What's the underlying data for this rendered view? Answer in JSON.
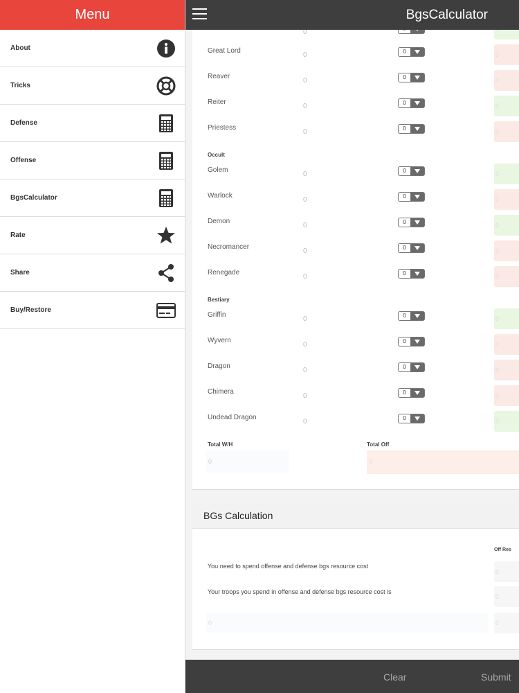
{
  "sidebar": {
    "title": "Menu",
    "items": [
      {
        "label": "About",
        "icon": "info-icon"
      },
      {
        "label": "Tricks",
        "icon": "lifebuoy-icon"
      },
      {
        "label": "Defense",
        "icon": "calculator-icon"
      },
      {
        "label": "Offense",
        "icon": "calculator-icon"
      },
      {
        "label": "BgsCalculator",
        "icon": "calculator-icon"
      },
      {
        "label": "Rate",
        "icon": "star-icon"
      },
      {
        "label": "Share",
        "icon": "share-icon"
      },
      {
        "label": "Buy/Restore",
        "icon": "credit-card-icon"
      }
    ]
  },
  "topbar": {
    "title": "BgsCalculator"
  },
  "units": {
    "top_partial": {
      "select_value": "0",
      "value": "0"
    },
    "rows": [
      {
        "name": "Great Lord",
        "value": "0",
        "select_value": "0"
      },
      {
        "name": "Reaver",
        "value": "0",
        "select_value": "0"
      },
      {
        "name": "Reiter",
        "value": "0",
        "select_value": "0"
      },
      {
        "name": "Priestess",
        "value": "0",
        "select_value": "0"
      },
      {
        "name": "Golem",
        "value": "0",
        "select_value": "0"
      },
      {
        "name": "Warlock",
        "value": "0",
        "select_value": "0"
      },
      {
        "name": "Demon",
        "value": "0",
        "select_value": "0"
      },
      {
        "name": "Necromancer",
        "value": "0",
        "select_value": "0"
      },
      {
        "name": "Renegade",
        "value": "0",
        "select_value": "0"
      },
      {
        "name": "Griffin",
        "value": "0",
        "select_value": "0"
      },
      {
        "name": "Wyvern",
        "value": "0",
        "select_value": "0"
      },
      {
        "name": "Dragon",
        "value": "0",
        "select_value": "0"
      },
      {
        "name": "Chimera",
        "value": "0",
        "select_value": "0"
      },
      {
        "name": "Undead Dragon",
        "value": "0",
        "select_value": "0"
      }
    ],
    "sections": {
      "occult": "Occult",
      "bestiary": "Bestiary"
    },
    "total_wh_label": "Total W/H",
    "total_off_label": "Total Off",
    "total_wh_value": "0",
    "total_off_value": "0",
    "res_values": [
      "0",
      "0",
      "0",
      "0",
      "0",
      "0",
      "0",
      "0",
      "0",
      "0",
      "0",
      "0",
      "0",
      "0",
      "0",
      "0"
    ]
  },
  "calculation": {
    "title": "BGs Calculation",
    "off_res_label": "Off Res",
    "line1": "You need to spend offense and defense bgs resource cost",
    "line2": "Your troops you spend in offense and defense bgs resource cost is",
    "box1": "0",
    "box2": "0",
    "box3": "0",
    "bottom_value": "0"
  },
  "bottombar": {
    "clear": "Clear",
    "submit": "Submit"
  }
}
